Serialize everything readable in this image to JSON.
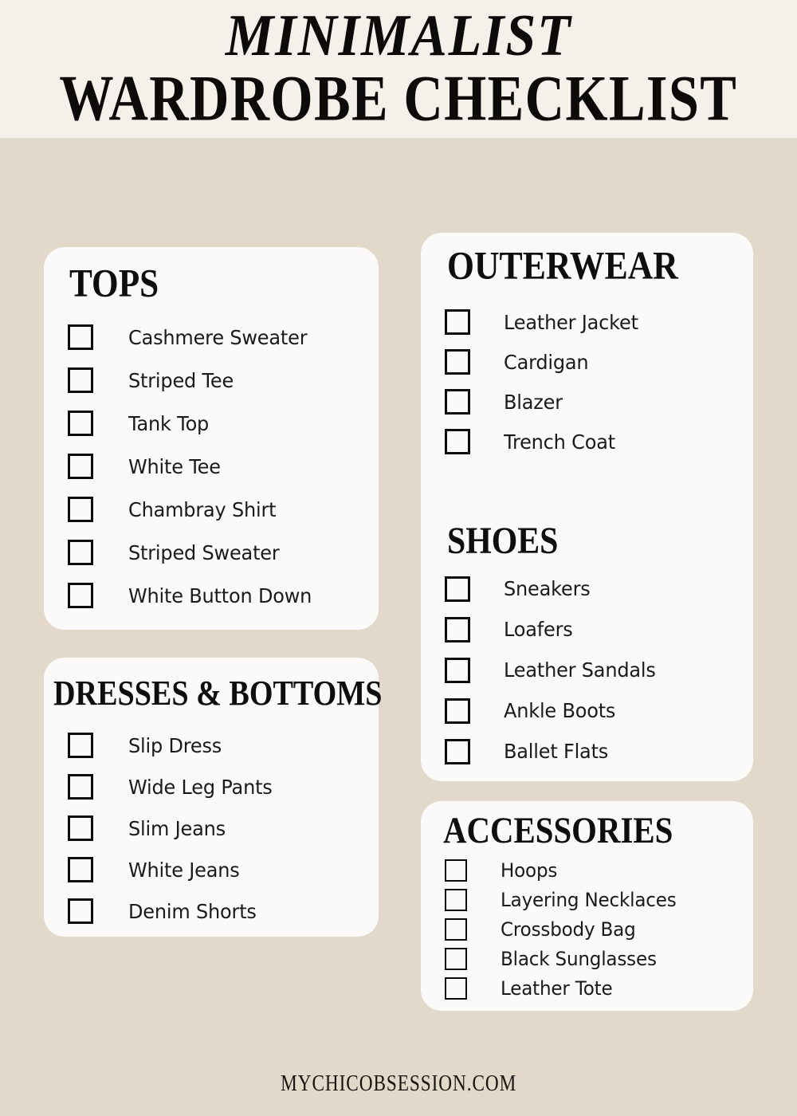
{
  "colors": {
    "header_band": "#F4F0EA",
    "page_background": "#E2D9CB",
    "card_background": "#FBFAF8",
    "text": "#1A1A1A",
    "heading": "#100E0C",
    "checkbox_border": "#0C0C0C"
  },
  "header": {
    "title_line_1": "MINIMALIST",
    "title_line_2": "WARDROBE CHECKLIST"
  },
  "footer": {
    "website": "MYCHICOBSESSION.COM"
  },
  "columns": {
    "left": [
      {
        "id": "tops",
        "title": "TOPS",
        "items": [
          {
            "label": "Cashmere Sweater",
            "checked": false
          },
          {
            "label": "Striped Tee",
            "checked": false
          },
          {
            "label": "Tank Top",
            "checked": false
          },
          {
            "label": "White Tee",
            "checked": false
          },
          {
            "label": "Chambray Shirt",
            "checked": false
          },
          {
            "label": "Striped Sweater",
            "checked": false
          },
          {
            "label": "White Button Down",
            "checked": false
          }
        ]
      },
      {
        "id": "dresses",
        "title": "DRESSES & BOTTOMS",
        "items": [
          {
            "label": "Slip Dress",
            "checked": false
          },
          {
            "label": "Wide Leg Pants",
            "checked": false
          },
          {
            "label": "Slim Jeans",
            "checked": false
          },
          {
            "label": "White Jeans",
            "checked": false
          },
          {
            "label": "Denim Shorts",
            "checked": false
          }
        ]
      }
    ],
    "right": [
      {
        "id": "outerwear",
        "title": "OUTERWEAR",
        "items": [
          {
            "label": "Leather Jacket",
            "checked": false
          },
          {
            "label": "Cardigan",
            "checked": false
          },
          {
            "label": "Blazer",
            "checked": false
          },
          {
            "label": "Trench Coat",
            "checked": false
          }
        ]
      },
      {
        "id": "shoes",
        "title": "SHOES",
        "items": [
          {
            "label": "Sneakers",
            "checked": false
          },
          {
            "label": "Loafers",
            "checked": false
          },
          {
            "label": "Leather Sandals",
            "checked": false
          },
          {
            "label": "Ankle Boots",
            "checked": false
          },
          {
            "label": "Ballet Flats",
            "checked": false
          }
        ]
      },
      {
        "id": "accessories",
        "title": "ACCESSORIES",
        "items": [
          {
            "label": "Hoops",
            "checked": false
          },
          {
            "label": "Layering Necklaces",
            "checked": false
          },
          {
            "label": "Crossbody Bag",
            "checked": false
          },
          {
            "label": "Black Sunglasses",
            "checked": false
          },
          {
            "label": "Leather Tote",
            "checked": false
          }
        ]
      }
    ]
  }
}
